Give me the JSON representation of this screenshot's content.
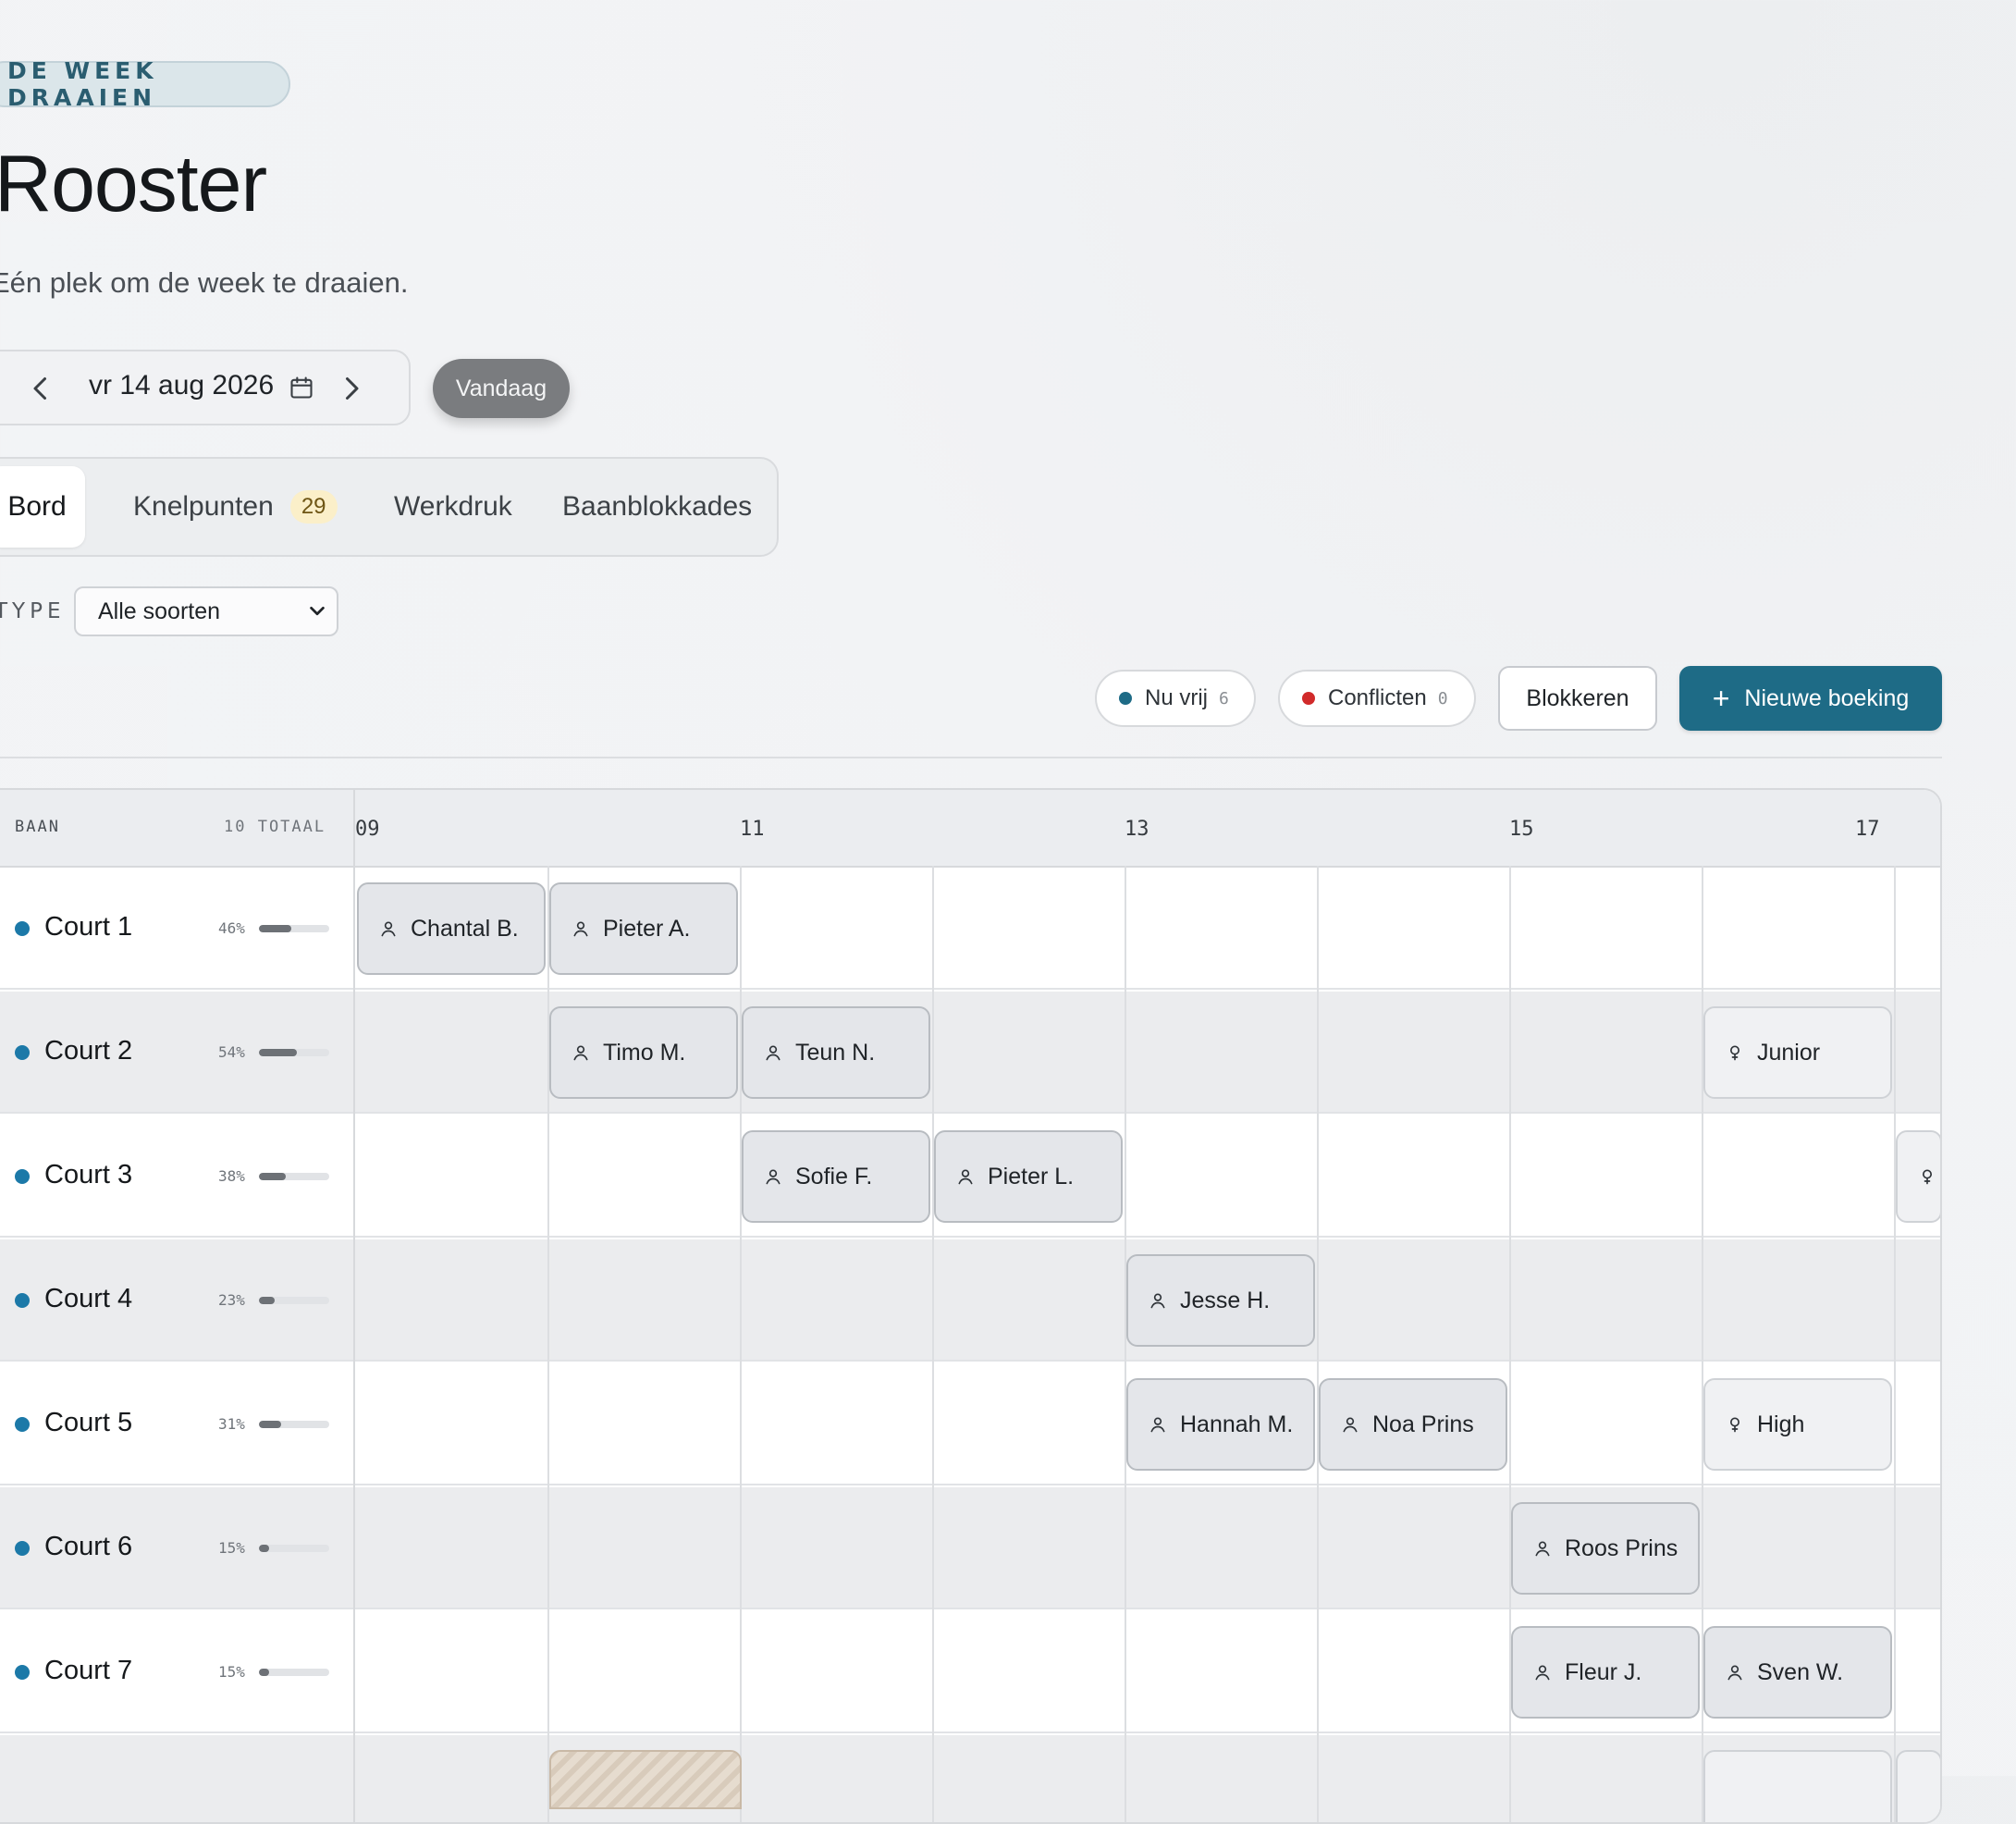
{
  "header": {
    "eyebrow": "DE WEEK DRAAIEN",
    "title": "Rooster",
    "subtitle": "Eén plek om de week te draaien."
  },
  "date_nav": {
    "date": "vr 14 aug 2026",
    "today_label": "Vandaag"
  },
  "tabs": [
    {
      "label": "Bord",
      "active": true
    },
    {
      "label": "Knelpunten",
      "badge": "29"
    },
    {
      "label": "Werkdruk"
    },
    {
      "label": "Baanblokkades"
    }
  ],
  "filter": {
    "label": "TYPE",
    "selected": "Alle soorten"
  },
  "toolbar": {
    "free": {
      "label": "Nu vrij",
      "count": "6",
      "color": "#1e6b86"
    },
    "conflicts": {
      "label": "Conflicten",
      "count": "0",
      "color": "#d12a2a"
    },
    "block_label": "Blokkeren",
    "new_label": "Nieuwe boeking",
    "accent": "#1e6b86"
  },
  "board": {
    "col_label": "BAAN",
    "total_label": "10 TOTAAL",
    "hours": [
      "09",
      "11",
      "13",
      "15",
      "17"
    ],
    "courts": [
      {
        "name": "Court 1",
        "pct": "46%",
        "util": 0.46
      },
      {
        "name": "Court 2",
        "pct": "54%",
        "util": 0.54
      },
      {
        "name": "Court 3",
        "pct": "38%",
        "util": 0.38
      },
      {
        "name": "Court 4",
        "pct": "23%",
        "util": 0.23
      },
      {
        "name": "Court 5",
        "pct": "31%",
        "util": 0.31
      },
      {
        "name": "Court 6",
        "pct": "15%",
        "util": 0.15
      },
      {
        "name": "Court 7",
        "pct": "15%",
        "util": 0.15
      }
    ],
    "bookings": [
      {
        "court": 0,
        "start": 9,
        "end": 10,
        "label": "Chantal B.",
        "kind": "person"
      },
      {
        "court": 0,
        "start": 10,
        "end": 11,
        "label": "Pieter A.",
        "kind": "person"
      },
      {
        "court": 1,
        "start": 10,
        "end": 11,
        "label": "Timo M.",
        "kind": "person"
      },
      {
        "court": 1,
        "start": 11,
        "end": 12,
        "label": "Teun N.",
        "kind": "person"
      },
      {
        "court": 1,
        "start": 16,
        "end": 17,
        "label": "Junior",
        "kind": "group"
      },
      {
        "court": 2,
        "start": 11,
        "end": 12,
        "label": "Sofie F.",
        "kind": "person"
      },
      {
        "court": 2,
        "start": 12,
        "end": 13,
        "label": "Pieter L.",
        "kind": "person"
      },
      {
        "court": 2,
        "start": 17,
        "end": 18,
        "label": "",
        "kind": "group"
      },
      {
        "court": 3,
        "start": 13,
        "end": 14,
        "label": "Jesse H.",
        "kind": "person"
      },
      {
        "court": 4,
        "start": 13,
        "end": 14,
        "label": "Hannah M.",
        "kind": "person"
      },
      {
        "court": 4,
        "start": 14,
        "end": 15,
        "label": "Noa Prins",
        "kind": "person"
      },
      {
        "court": 4,
        "start": 16,
        "end": 17,
        "label": "High",
        "kind": "group"
      },
      {
        "court": 5,
        "start": 15,
        "end": 16,
        "label": "Roos Prins",
        "kind": "person"
      },
      {
        "court": 6,
        "start": 15,
        "end": 16,
        "label": "Fleur J.",
        "kind": "person"
      },
      {
        "court": 6,
        "start": 16,
        "end": 17,
        "label": "Sven W.",
        "kind": "person"
      }
    ]
  }
}
